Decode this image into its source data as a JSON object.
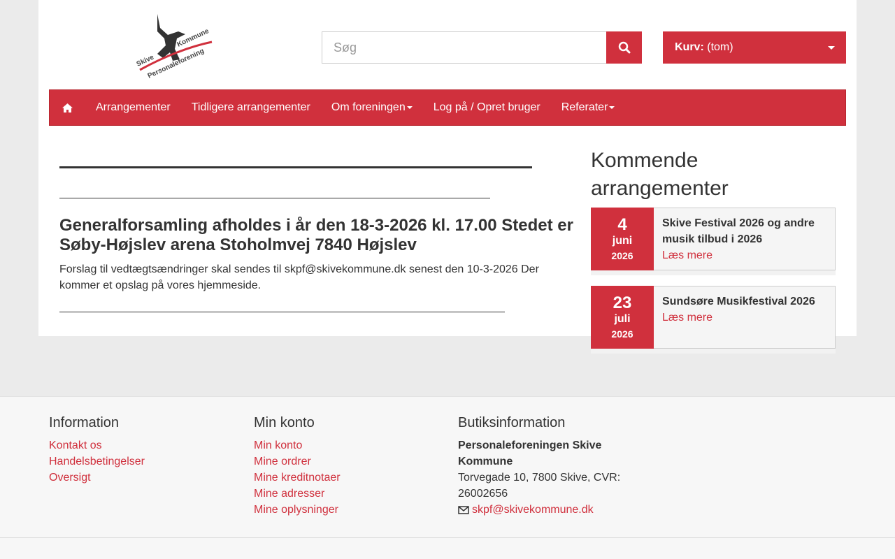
{
  "header": {
    "logo_text": "Skive Kommune Personaleforening",
    "search_placeholder": "Søg",
    "cart_label": "Kurv:",
    "cart_value": "(tom)"
  },
  "nav": {
    "items": [
      "Arrangementer",
      "Tidligere arrangementer",
      "Om foreningen",
      "Log på / Opret bruger",
      "Referater"
    ]
  },
  "main": {
    "heading": "Generalforsamling afholdes i år den 18-3-2026 kl. 17.00 Stedet er Søby-Højslev arena Stoholmvej 7840 Højslev",
    "text": "Forslag til vedtægtsændringer skal sendes til skpf@skivekommune.dk senest den 10-3-2026 Der kommer et opslag på vores hjemmeside."
  },
  "sidebar": {
    "title": "Kommende arrangementer",
    "events": [
      {
        "day": "4",
        "month": "juni",
        "year": "2026",
        "title": "Skive Festival 2026 og andre musik tilbud i 2026",
        "link": "Læs mere"
      },
      {
        "day": "23",
        "month": "juli",
        "year": "2026",
        "title": "Sundsøre Musikfestival 2026",
        "link": "Læs mere"
      }
    ]
  },
  "footer": {
    "info": {
      "title": "Information",
      "links": [
        "Kontakt os",
        "Handelsbetingelser",
        "Oversigt"
      ]
    },
    "account": {
      "title": "Min konto",
      "links": [
        "Min konto",
        "Mine ordrer",
        "Mine kreditnotaer",
        "Mine adresser",
        "Mine oplysninger"
      ]
    },
    "shop": {
      "title": "Butiksinformation",
      "name": "Personaleforeningen Skive Kommune",
      "address": "Torvegade 10, 7800 Skive, CVR: 26002656",
      "email": "skpf@skivekommune.dk"
    }
  }
}
